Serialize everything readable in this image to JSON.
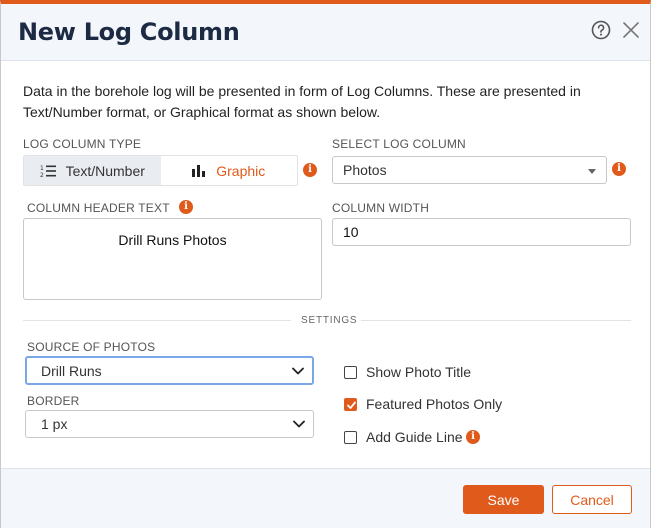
{
  "dialog": {
    "title": "New Log Column",
    "description": "Data in the borehole log will be presented in form of Log Columns. These are presented in Text/Number format, or Graphical format as shown below."
  },
  "log_column_type": {
    "label": "LOG COLUMN TYPE",
    "options": [
      {
        "label": "Text/Number",
        "icon": "numbered-list-icon",
        "active": true
      },
      {
        "label": "Graphic",
        "icon": "bar-chart-icon",
        "active": false
      }
    ]
  },
  "select_log_column": {
    "label": "SELECT LOG COLUMN",
    "value": "Photos"
  },
  "column_header": {
    "label": "COLUMN HEADER TEXT",
    "value": "Drill Runs Photos"
  },
  "column_width": {
    "label": "COLUMN WIDTH",
    "value": "10"
  },
  "settings": {
    "label": "SETTINGS",
    "source_of_photos": {
      "label": "SOURCE OF PHOTOS",
      "value": "Drill Runs"
    },
    "border": {
      "label": "BORDER",
      "value": "1 px"
    },
    "checkboxes": [
      {
        "label": "Show Photo Title",
        "checked": false
      },
      {
        "label": "Featured Photos Only",
        "checked": true
      },
      {
        "label": "Add Guide Line",
        "checked": false
      }
    ]
  },
  "footer": {
    "save_label": "Save",
    "cancel_label": "Cancel"
  },
  "colors": {
    "accent": "#e05a1b",
    "title": "#1d2a44",
    "focus": "#7aa7e6"
  },
  "info_glyph": "i"
}
